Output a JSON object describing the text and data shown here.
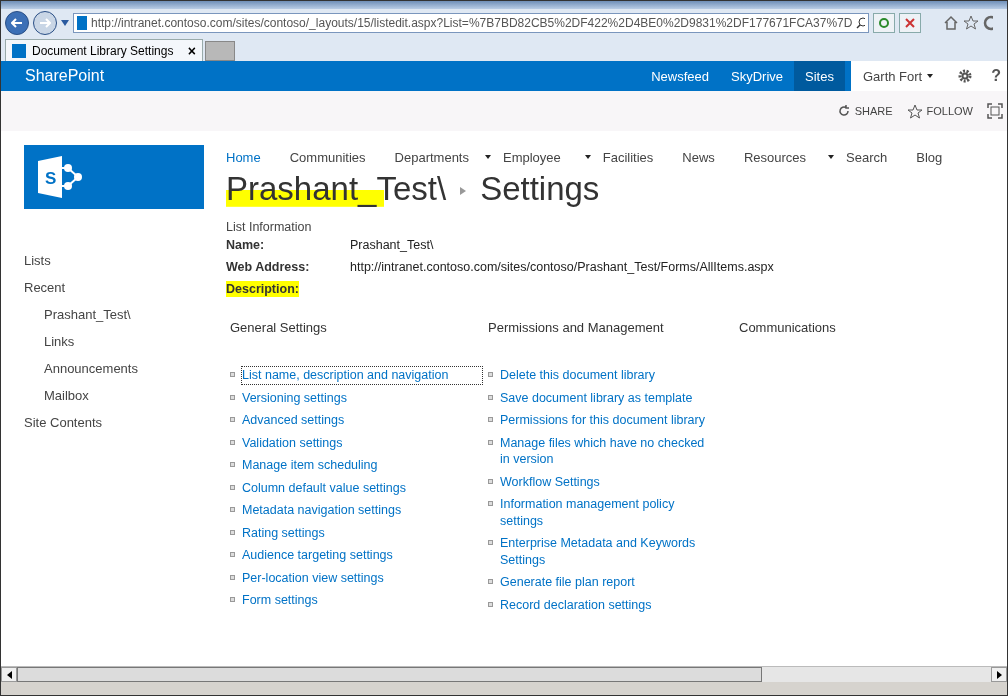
{
  "browser": {
    "address": "http://intranet.contoso.com/sites/contoso/_layouts/15/listedit.aspx?List=%7B7BD82CB5%2DF422%2D4BE0%2D9831%2DF177671FCA37%7D",
    "tabs": [
      {
        "label": "Document Library Settings",
        "selected": true,
        "close": "×"
      }
    ]
  },
  "suite_bar": {
    "brand": "SharePoint",
    "links": [
      {
        "label": "Newsfeed",
        "selected": false
      },
      {
        "label": "SkyDrive",
        "selected": false
      },
      {
        "label": "Sites",
        "selected": true
      }
    ],
    "user": "Garth Fort",
    "help": "?"
  },
  "actions": [
    {
      "kind": "share",
      "label": "SHARE"
    },
    {
      "kind": "follow",
      "label": "FOLLOW"
    }
  ],
  "top_nav": [
    {
      "label": "Home",
      "selected": true,
      "dropdown": false
    },
    {
      "label": "Communities",
      "selected": false,
      "dropdown": false
    },
    {
      "label": "Departments",
      "selected": false,
      "dropdown": true
    },
    {
      "label": "Employee",
      "selected": false,
      "dropdown": true
    },
    {
      "label": "Facilities",
      "selected": false,
      "dropdown": false
    },
    {
      "label": "News",
      "selected": false,
      "dropdown": false
    },
    {
      "label": "Resources",
      "selected": false,
      "dropdown": true
    },
    {
      "label": "Search",
      "selected": false,
      "dropdown": false
    },
    {
      "label": "Blog",
      "selected": false,
      "dropdown": false
    }
  ],
  "breadcrumb": [
    {
      "label": "Prashant_Test\\",
      "highlighted": true
    },
    {
      "label": "Settings",
      "highlighted": false
    }
  ],
  "logo": {
    "letter": "S"
  },
  "left_nav": [
    {
      "label": "Lists"
    },
    {
      "label": "Recent",
      "children": [
        {
          "label": "Prashant_Test\\"
        },
        {
          "label": "Links"
        },
        {
          "label": "Announcements"
        },
        {
          "label": "Mailbox"
        }
      ]
    },
    {
      "label": "Site Contents"
    }
  ],
  "list_information": {
    "heading": "List Information",
    "fields": [
      {
        "label": "Name:",
        "value": "Prashant_Test\\",
        "highlighted": false
      },
      {
        "label": "Web Address:",
        "value": "http://intranet.contoso.com/sites/contoso/Prashant_Test/Forms/AllItems.aspx",
        "highlighted": false
      },
      {
        "label": "Description:",
        "highlighted": true
      }
    ]
  },
  "sections": [
    {
      "heading": "General Settings",
      "links": [
        {
          "label": "List name, description and navigation",
          "focused": true
        },
        {
          "label": "Versioning settings",
          "focused": false
        },
        {
          "label": "Advanced settings",
          "focused": false
        },
        {
          "label": "Validation settings",
          "focused": false
        },
        {
          "label": "Manage item scheduling",
          "focused": false
        },
        {
          "label": "Column default value settings",
          "focused": false
        },
        {
          "label": "Metadata navigation settings",
          "focused": false
        },
        {
          "label": "Rating settings",
          "focused": false
        },
        {
          "label": "Audience targeting settings",
          "focused": false
        },
        {
          "label": "Per-location view settings",
          "focused": false
        },
        {
          "label": "Form settings",
          "focused": false
        }
      ]
    },
    {
      "heading": "Permissions and Management",
      "links": [
        {
          "label": "Delete this document library",
          "focused": false
        },
        {
          "label": "Save document library as template",
          "focused": false
        },
        {
          "label": "Permissions for this document library",
          "focused": false
        },
        {
          "label": "Manage files which have no checked in version",
          "focused": false
        },
        {
          "label": "Workflow Settings",
          "focused": false
        },
        {
          "label": "Information management policy settings",
          "focused": false
        },
        {
          "label": "Enterprise Metadata and Keywords Settings",
          "focused": false
        },
        {
          "label": "Generate file plan report",
          "focused": false
        },
        {
          "label": "Record declaration settings",
          "focused": false
        }
      ]
    },
    {
      "heading": "Communications"
    }
  ]
}
